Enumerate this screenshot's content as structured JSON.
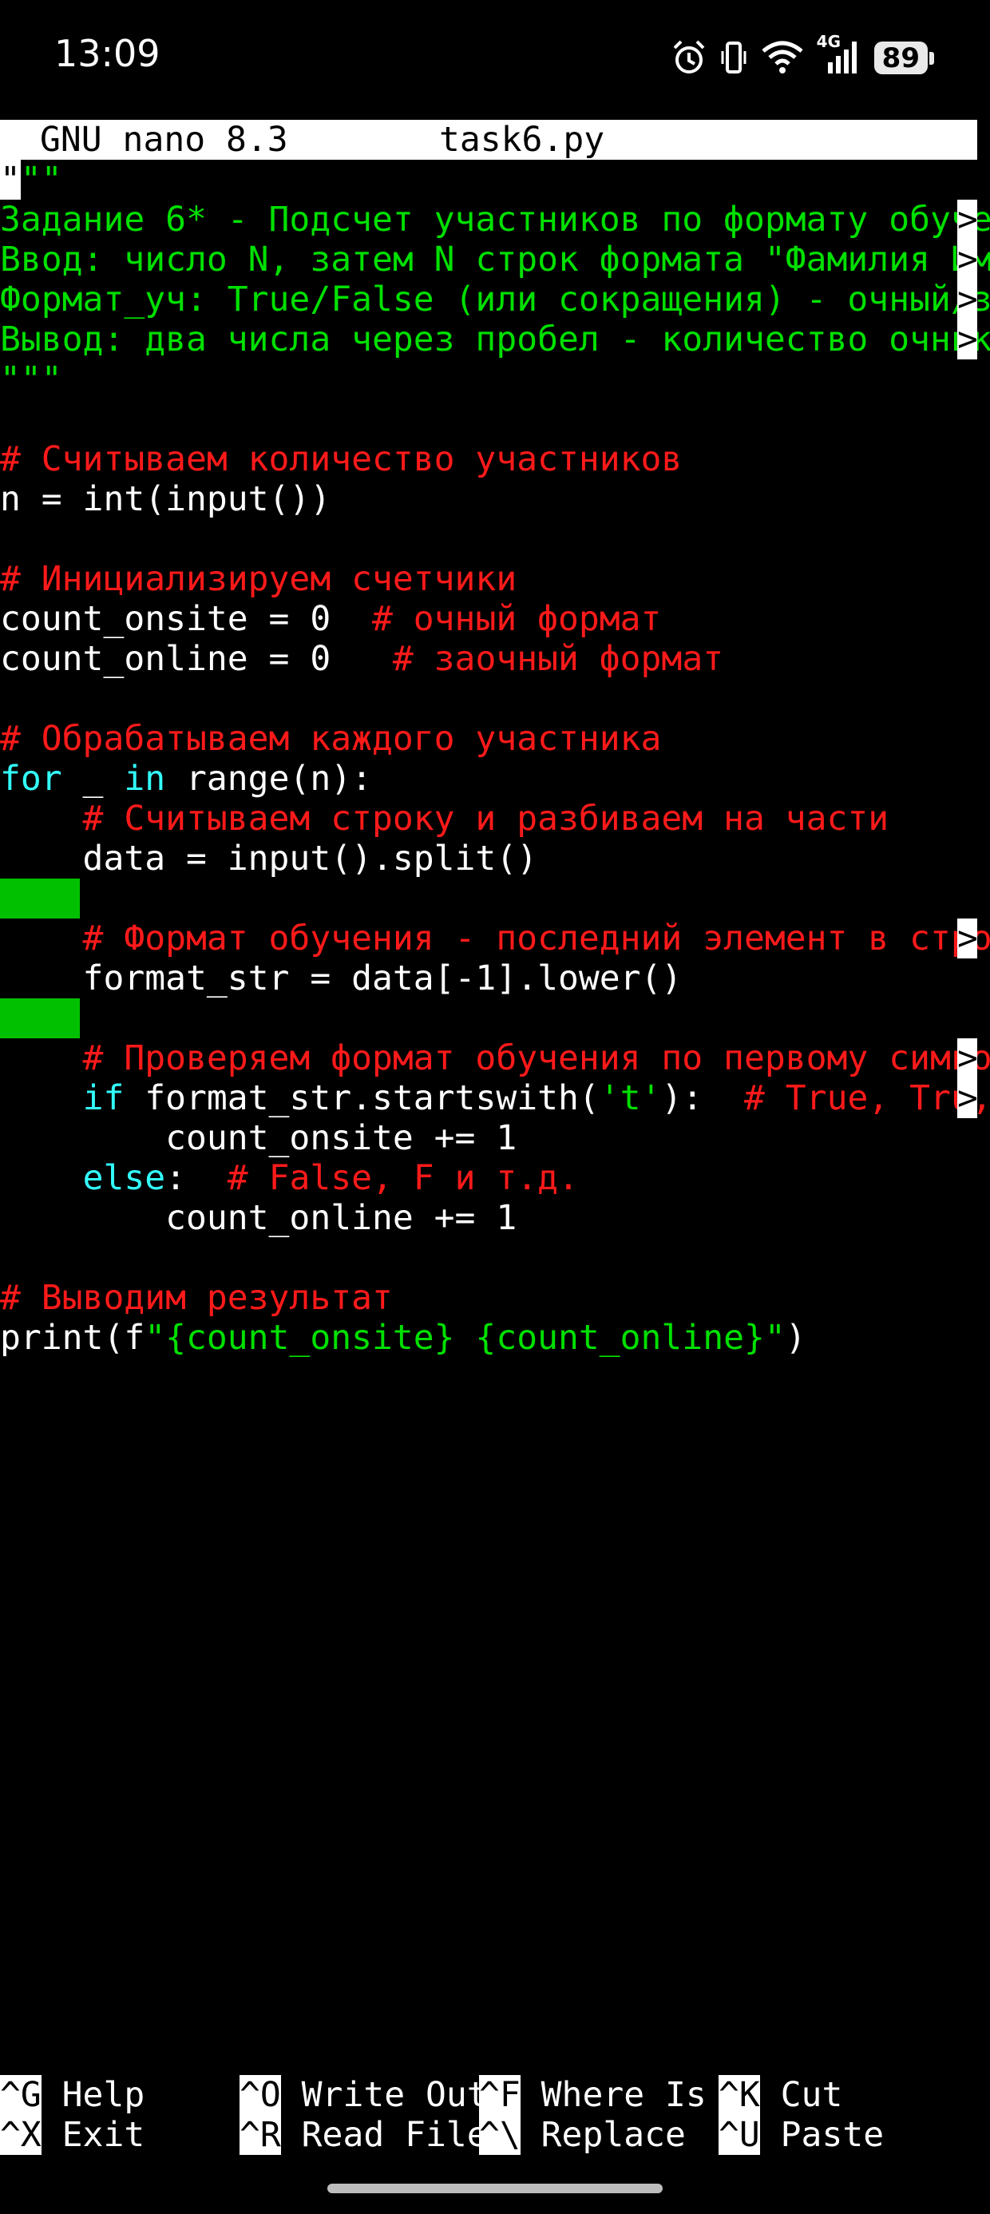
{
  "status_bar": {
    "time": "13:09",
    "network": "4G",
    "battery": "89",
    "icons": [
      "alarm-icon",
      "vibrate-icon",
      "wifi-icon",
      "signal-icon",
      "battery-icon"
    ]
  },
  "titlebar": {
    "program": "GNU nano 8.3",
    "filename": "task6.py"
  },
  "code": {
    "l1_quote": "\"",
    "l1_rest": "\"\"",
    "l2": "Задание 6* - Подсчет участников по формату обуче",
    "l3": "Ввод: число N, затем N строк формата \"Фамилия Им",
    "l4": "Формат_уч: True/False (или сокращения) - очный/з",
    "l5": "Вывод: два числа через пробел - количество очник",
    "l6": "\"\"\"",
    "l8": "# Считываем количество участников",
    "l9": "n = int(input())",
    "l11": "# Инициализируем счетчики",
    "l12_code": "count_onsite = 0  ",
    "l12_comment": "# очный формат",
    "l13_code": "count_online = 0   ",
    "l13_comment": "# заочный формат",
    "l15": "# Обрабатываем каждого участника",
    "l16_for": "for",
    "l16_mid": " _ ",
    "l16_in": "in",
    "l16_rest": " range(n):",
    "l17": "    # Считываем строку и разбиваем на части",
    "l18": "    data = input().split()",
    "l20": "    # Формат обучения - последний элемент в стро",
    "l21": "    format_str = data[-1].lower()",
    "l23": "    # Проверяем формат обучения по первому симво",
    "l24_indent": "    ",
    "l24_if": "if",
    "l24_code": " format_str.startswith(",
    "l24_str": "'t'",
    "l24_close": "):  ",
    "l24_comment": "# True, Tru,",
    "l25": "        count_onsite += 1",
    "l26_indent": "    ",
    "l26_else": "else",
    "l26_colon": ":  ",
    "l26_comment": "# False, F и т.д.",
    "l27": "        count_online += 1",
    "l29": "# Выводим результат",
    "l30_a": "print(f",
    "l30_str": "\"{count_onsite} {count_online}\"",
    "l30_b": ")",
    "continuation": ">"
  },
  "shortcuts": [
    {
      "key": "^G",
      "label": " Help"
    },
    {
      "key": "^O",
      "label": " Write Out"
    },
    {
      "key": "^F",
      "label": " Where Is"
    },
    {
      "key": "^K",
      "label": " Cut"
    },
    {
      "key": "^X",
      "label": " Exit"
    },
    {
      "key": "^R",
      "label": " Read File"
    },
    {
      "key": "^\\",
      "label": " Replace"
    },
    {
      "key": "^U",
      "label": " Paste"
    }
  ]
}
